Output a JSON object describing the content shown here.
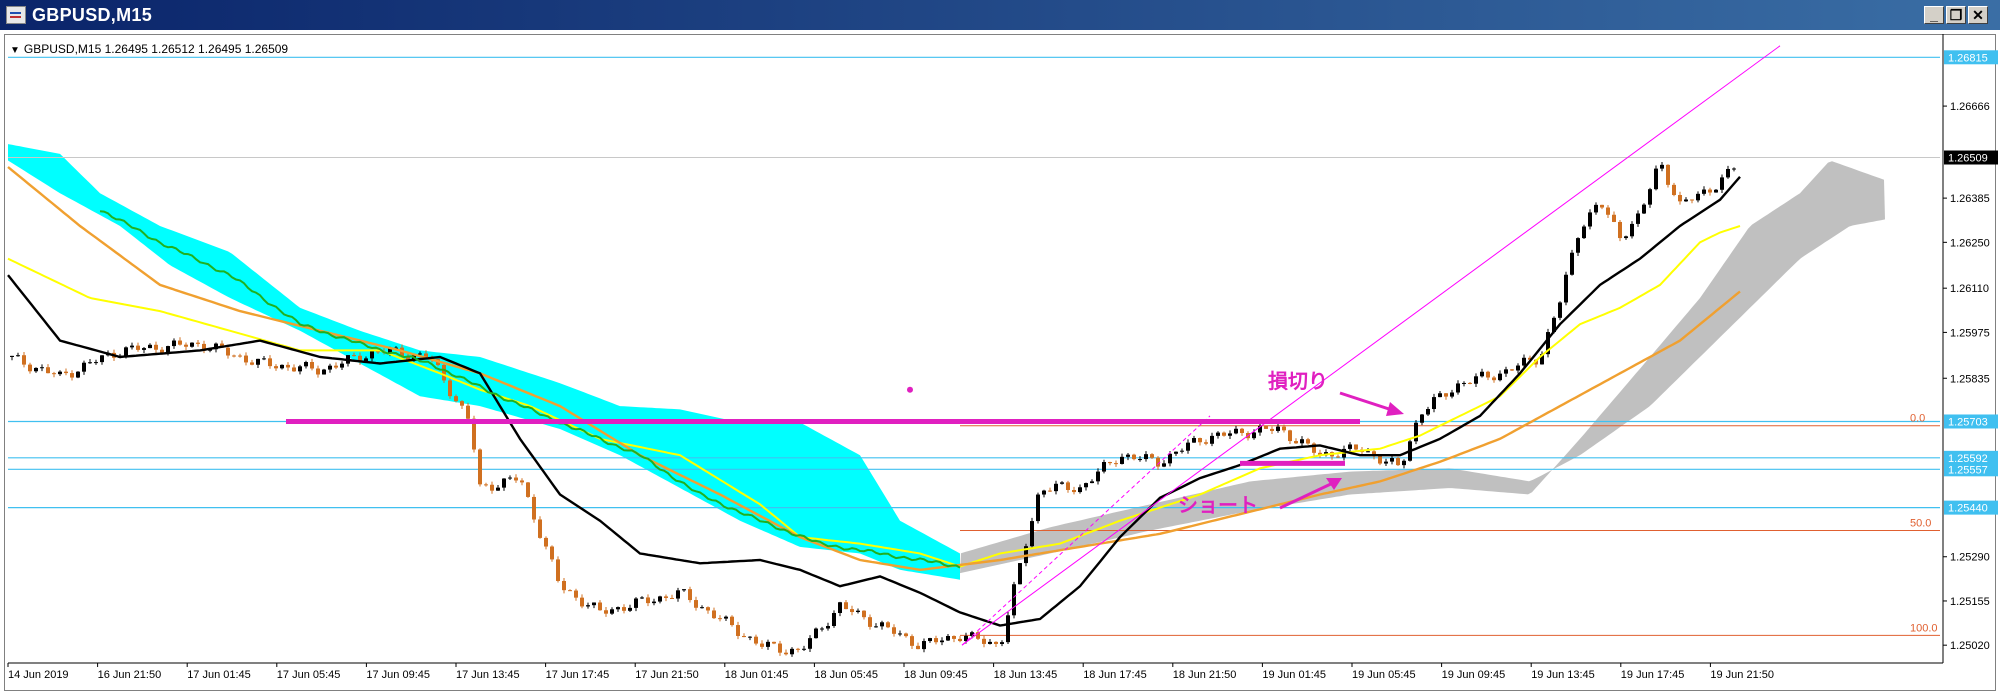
{
  "window": {
    "title": "GBPUSD,M15",
    "icon": "chart-window-icon",
    "minimize_label": "_",
    "restore_label": "❐",
    "close_label": "✕"
  },
  "symbol_info": {
    "arrow": "▼",
    "text": "GBPUSD,M15  1.26495 1.26512 1.26495 1.26509"
  },
  "colors": {
    "ichimoku_cloud_bull": "#00ffff",
    "ichimoku_cloud_bear": "#c0c0c0",
    "kijun": "#ffff00",
    "tenkan": "#e0e000",
    "ma_black": "#000000",
    "ma_orange": "#f0a030",
    "chikou_green": "#20b020",
    "trendline_magenta": "#ff00ff",
    "annotation_magenta": "#e020c0",
    "hline_cyan": "#40c0f0",
    "fibo_orange": "#e06030",
    "candle_bull": "#000000",
    "candle_bear": "#d07020"
  },
  "annotations": {
    "stop_loss_label": "損切り",
    "short_label": "ショート"
  },
  "chart_data": {
    "type": "candlestick",
    "symbol": "GBPUSD",
    "timeframe": "M15",
    "last_ohlc": {
      "open": 1.26495,
      "high": 1.26512,
      "low": 1.26495,
      "close": 1.26509
    },
    "y_axis": {
      "ylim": [
        1.2499,
        1.2688
      ],
      "ticks": [
        "1.26666",
        "1.26385",
        "1.26250",
        "1.26110",
        "1.25975",
        "1.25835",
        "1.25290",
        "1.25155",
        "1.25020"
      ]
    },
    "x_axis": {
      "ticks": [
        "14 Jun 2019",
        "16 Jun 21:50",
        "17 Jun 01:45",
        "17 Jun 05:45",
        "17 Jun 09:45",
        "17 Jun 13:45",
        "17 Jun 17:45",
        "17 Jun 21:50",
        "18 Jun 01:45",
        "18 Jun 05:45",
        "18 Jun 09:45",
        "18 Jun 13:45",
        "18 Jun 17:45",
        "18 Jun 21:50",
        "19 Jun 01:45",
        "19 Jun 05:45",
        "19 Jun 09:45",
        "19 Jun 13:45",
        "19 Jun 17:45",
        "19 Jun 21:50"
      ]
    },
    "horizontal_lines": [
      {
        "price": 1.26815,
        "label": "1.26815"
      },
      {
        "price": 1.25703,
        "label": "1.25703"
      },
      {
        "price": 1.25592,
        "label": "1.25592"
      },
      {
        "price": 1.25557,
        "label": "1.25557"
      },
      {
        "price": 1.2544,
        "label": "1.25440"
      }
    ],
    "current_price": {
      "price": 1.26509,
      "label": "1.26509"
    },
    "fibonacci": {
      "levels": [
        {
          "label": "0.0",
          "price": 1.2569
        },
        {
          "label": "50.0",
          "price": 1.2537
        },
        {
          "label": "100.0",
          "price": 1.2505
        }
      ]
    },
    "annotation_dot_price": 1.258,
    "stop_loss_line_price": 1.25703,
    "short_line_price": 1.25575
  }
}
